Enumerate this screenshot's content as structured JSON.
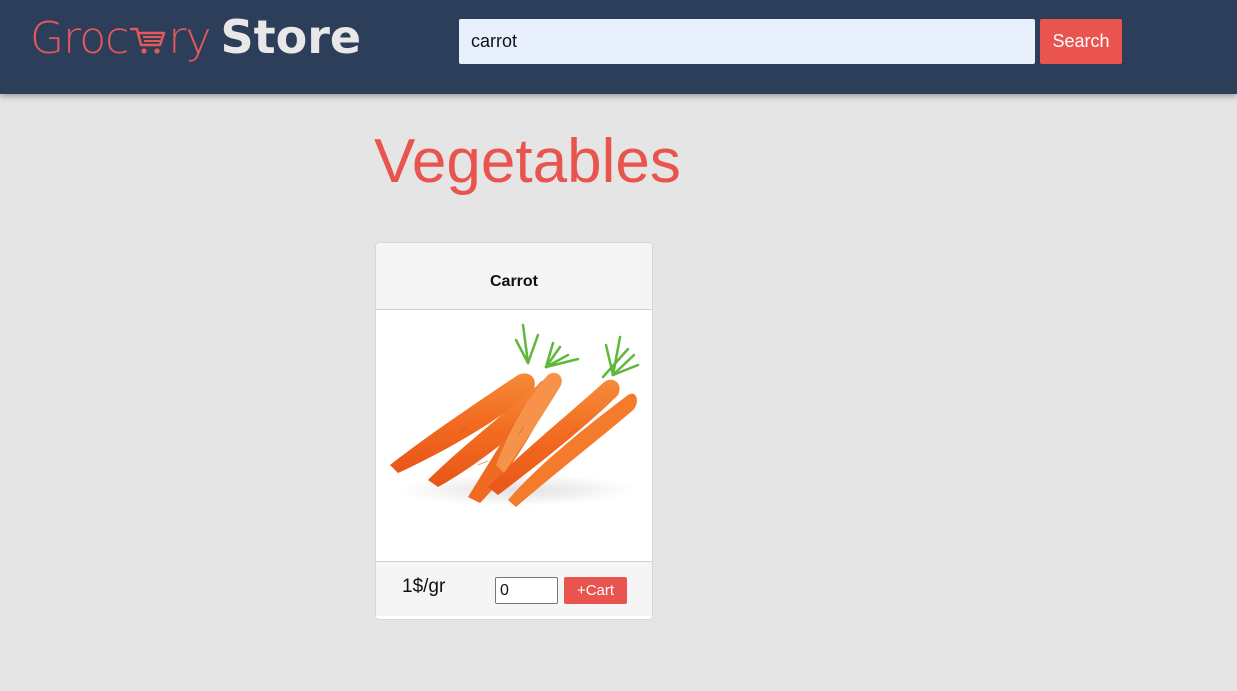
{
  "brand": {
    "logo_part1": "Groc",
    "logo_part2": "ry",
    "logo_store": "Store",
    "cart_icon": "shopping-cart-icon",
    "colors": {
      "accent": "#e9544f",
      "header_bg": "#2c3e5a",
      "store_text": "#e8e8e8"
    }
  },
  "search": {
    "value": "carrot",
    "button_label": "Search"
  },
  "category": {
    "title": "Vegetables"
  },
  "products": [
    {
      "name": "Carrot",
      "image": "carrot-bunch-image",
      "price": "1$/gr",
      "quantity": "0",
      "add_label": "+Cart"
    }
  ]
}
